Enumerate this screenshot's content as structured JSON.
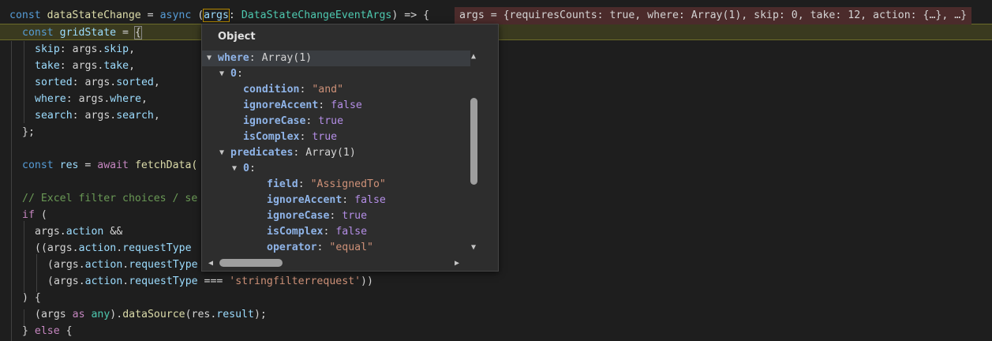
{
  "inline_hint": "args = {requiresCounts: true, where: Array(1), skip: 0, take: 12, action: {…}, …}",
  "popup": {
    "title": "Object",
    "rows": [
      {
        "key": "where",
        "sep": ": ",
        "val": "Array(1)",
        "vtype": "t"
      },
      {
        "key": "0",
        "sep": ":",
        "val": "",
        "vtype": "t"
      },
      {
        "key": "condition",
        "sep": ": ",
        "val": "\"and\"",
        "vtype": "s"
      },
      {
        "key": "ignoreAccent",
        "sep": ": ",
        "val": "false",
        "vtype": "b"
      },
      {
        "key": "ignoreCase",
        "sep": ": ",
        "val": "true",
        "vtype": "b"
      },
      {
        "key": "isComplex",
        "sep": ": ",
        "val": "true",
        "vtype": "b"
      },
      {
        "key": "predicates",
        "sep": ": ",
        "val": "Array(1)",
        "vtype": "t"
      },
      {
        "key": "0",
        "sep": ":",
        "val": "",
        "vtype": "t"
      },
      {
        "key": "field",
        "sep": ": ",
        "val": "\"AssignedTo\"",
        "vtype": "s"
      },
      {
        "key": "ignoreAccent",
        "sep": ": ",
        "val": "false",
        "vtype": "b"
      },
      {
        "key": "ignoreCase",
        "sep": ": ",
        "val": "true",
        "vtype": "b"
      },
      {
        "key": "isComplex",
        "sep": ": ",
        "val": "false",
        "vtype": "b"
      },
      {
        "key": "operator",
        "sep": ": ",
        "val": "\"equal\"",
        "vtype": "s"
      }
    ]
  },
  "code": {
    "l1": {
      "a": "const ",
      "b": "dataStateChange",
      "c": " = ",
      "d": "async ",
      "e": "(",
      "f": "args",
      ":": ": ",
      "g": "DataStateChangeEventArgs",
      "h": ") => {"
    },
    "l2": {
      "a": "const ",
      "b": "gridState",
      "c": " = ",
      "d": "{"
    },
    "l3": {
      "k": "skip",
      ":": ": args.",
      "v": "skip",
      ",": ","
    },
    "l4": {
      "k": "take",
      ":": ": args.",
      "v": "take",
      ",": ","
    },
    "l5": {
      "k": "sorted",
      ":": ": args.",
      "v": "sorted",
      ",": ","
    },
    "l6": {
      "k": "where",
      ":": ": args.",
      "v": "where",
      ",": ","
    },
    "l7": {
      "k": "search",
      ":": ": args.",
      "v": "search",
      ",": ","
    },
    "l8": "};",
    "l10": {
      "a": "const ",
      "b": "res",
      "c": " = ",
      "d": "await ",
      "e": "fetchData("
    },
    "l12": "// Excel filter choices / se",
    "l13": {
      "a": "if",
      "b": " ("
    },
    "l14": {
      "a": "args.",
      "b": "action",
      "c": " &&"
    },
    "l15": {
      "a": "((args.",
      "b": "action",
      "c": ".",
      "d": "requestType"
    },
    "l16": {
      "a": "(args.",
      "b": "action",
      "c": ".",
      "d": "requestType"
    },
    "l17": {
      "a": "(args.",
      "b": "action",
      "c": ".",
      "d": "requestType",
      "e": " === ",
      "f": "'stringfilterrequest'",
      "g": "))"
    },
    "l18": ") {",
    "l19": {
      "a": "(args ",
      "b": "as ",
      "c": "any",
      "d": ").",
      "e": "dataSource",
      "f": "(res.",
      "g": "result",
      "h": ");"
    },
    "l20": {
      "a": "} ",
      "b": "else",
      "c": " {"
    }
  }
}
